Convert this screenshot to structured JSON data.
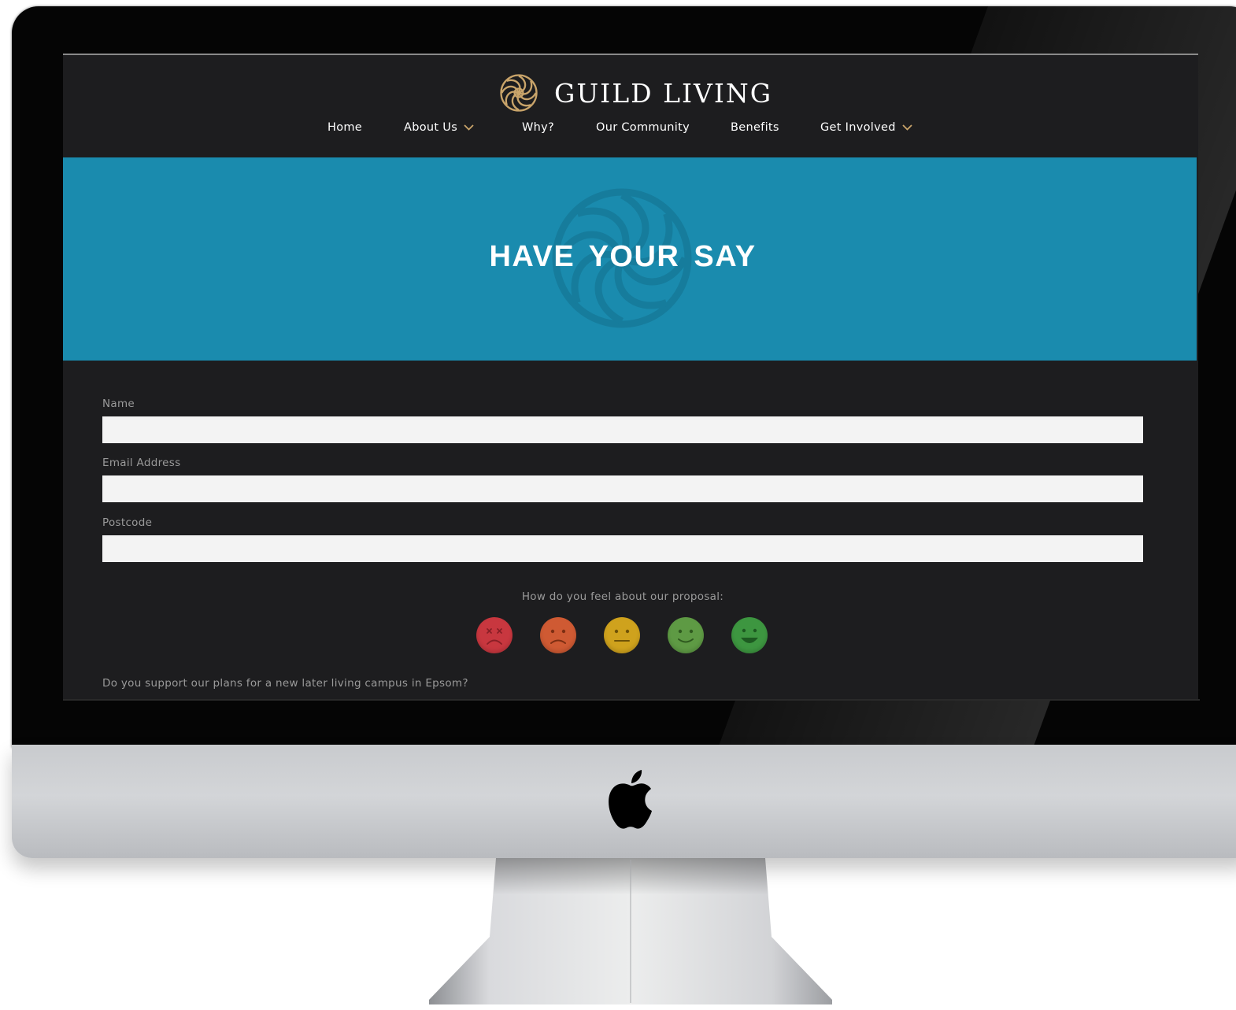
{
  "brand": {
    "name": "GUILD LIVING",
    "logo_icon": "floral-rosette-icon"
  },
  "nav": {
    "items": [
      {
        "label": "Home",
        "has_dropdown": false
      },
      {
        "label": "About Us",
        "has_dropdown": true
      },
      {
        "label": "Why?",
        "has_dropdown": false
      },
      {
        "label": "Our Community",
        "has_dropdown": false
      },
      {
        "label": "Benefits",
        "has_dropdown": false
      },
      {
        "label": "Get Involved",
        "has_dropdown": true
      }
    ]
  },
  "hero": {
    "title": "HAVE YOUR SAY",
    "background_color": "#1a8bae"
  },
  "form": {
    "fields": [
      {
        "label": "Name",
        "value": ""
      },
      {
        "label": "Email Address",
        "value": ""
      },
      {
        "label": "Postcode",
        "value": ""
      }
    ],
    "feeling_prompt": "How do you feel about our proposal:",
    "faces": [
      {
        "icon": "very-unhappy-face-icon",
        "color": "#c8373f"
      },
      {
        "icon": "unhappy-face-icon",
        "color": "#cf5a33"
      },
      {
        "icon": "neutral-face-icon",
        "color": "#cfa21d"
      },
      {
        "icon": "happy-face-icon",
        "color": "#5e9a44"
      },
      {
        "icon": "very-happy-face-icon",
        "color": "#3d9640"
      }
    ],
    "support_question": "Do you support our plans for a new later living campus in Epsom?"
  },
  "colors": {
    "page_background": "#1d1d1f",
    "accent_gold": "#c9a46a"
  }
}
